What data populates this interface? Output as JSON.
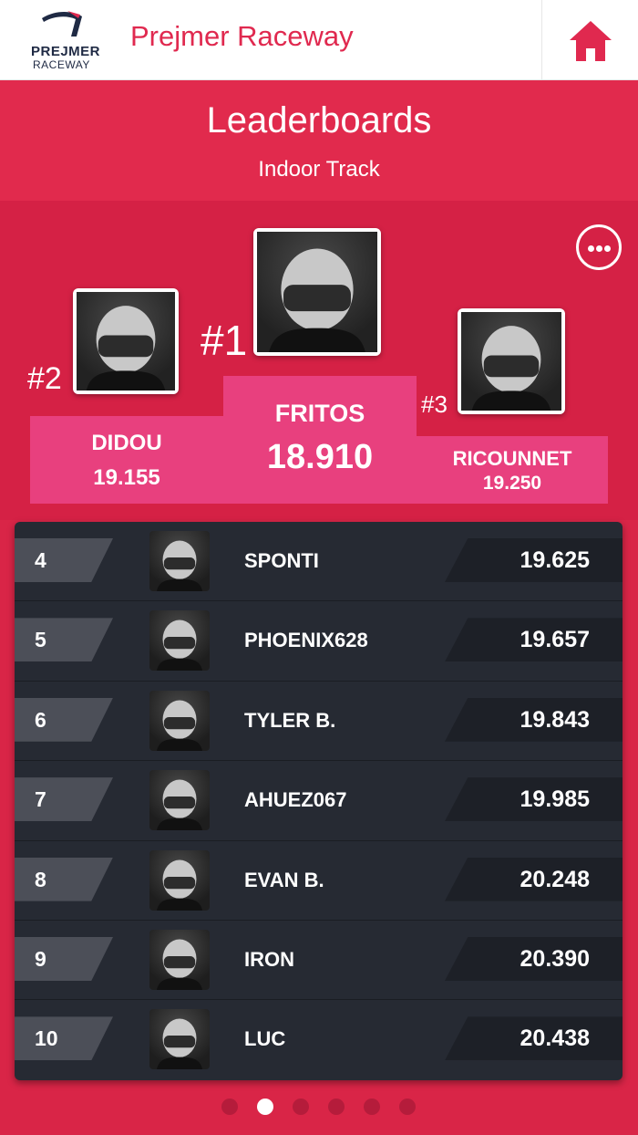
{
  "header": {
    "logo_line1": "PREJMER",
    "logo_line2": "RACEWAY",
    "app_title": "Prejmer Raceway",
    "home_icon": "home-icon"
  },
  "page": {
    "title": "Leaderboards",
    "subtitle": "Indoor Track",
    "more_icon": "more-icon"
  },
  "podium": {
    "first": {
      "rank": "#1",
      "name": "FRITOS",
      "time": "18.910"
    },
    "second": {
      "rank": "#2",
      "name": "DIDOU",
      "time": "19.155"
    },
    "third": {
      "rank": "#3",
      "name": "RICOUNNET",
      "time": "19.250"
    }
  },
  "list": [
    {
      "pos": "4",
      "name": "SPONTI",
      "time": "19.625"
    },
    {
      "pos": "5",
      "name": "PHOENIX628",
      "time": "19.657"
    },
    {
      "pos": "6",
      "name": "TYLER B.",
      "time": "19.843"
    },
    {
      "pos": "7",
      "name": "AHUEZ067",
      "time": "19.985"
    },
    {
      "pos": "8",
      "name": "EVAN B.",
      "time": "20.248"
    },
    {
      "pos": "9",
      "name": "IRON",
      "time": "20.390"
    },
    {
      "pos": "10",
      "name": "LUC",
      "time": "20.438"
    }
  ],
  "pagination": {
    "count": 6,
    "active": 2
  },
  "colors": {
    "accent": "#e0294f",
    "podium_block": "#e8407e",
    "list_bg": "#262a33"
  }
}
